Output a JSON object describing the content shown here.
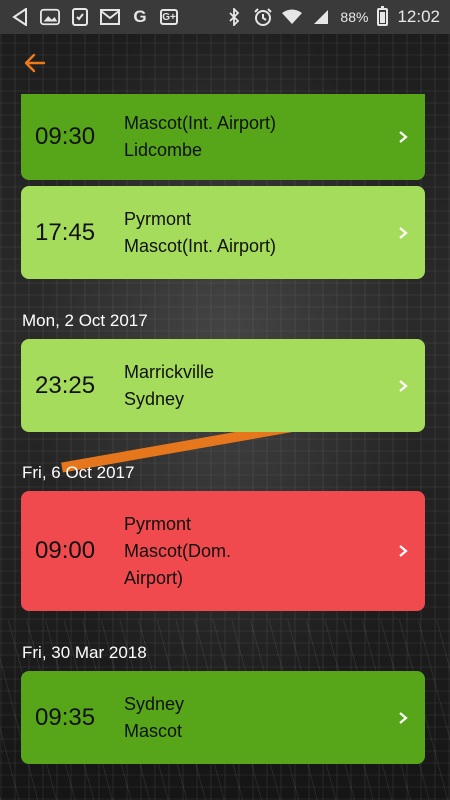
{
  "status_bar": {
    "battery": "88%",
    "time": "12:02",
    "icons": [
      "back-arrow-icon",
      "image-icon",
      "tablet-check-icon",
      "mail-icon",
      "google-g-icon",
      "google-plus-icon",
      "bluetooth-icon",
      "alarm-icon",
      "wifi-icon",
      "signal-icon",
      "battery-icon"
    ]
  },
  "appbar": {
    "back_icon": "arrow-left-icon",
    "accent": "#f07a1a"
  },
  "groups": [
    {
      "date": "",
      "trips": [
        {
          "time": "09:30",
          "from": "Mascot(Int. Airport)",
          "to": "Lidcombe",
          "color": "#57a518"
        },
        {
          "time": "17:45",
          "from": "Pyrmont",
          "to": "Mascot(Int. Airport)",
          "color": "#a6dc5b"
        }
      ]
    },
    {
      "date": "Mon, 2 Oct 2017",
      "trips": [
        {
          "time": "23:25",
          "from": "Marrickville",
          "to": "Sydney",
          "color": "#a6dc5b"
        }
      ]
    },
    {
      "date": "Fri, 6 Oct 2017",
      "trips": [
        {
          "time": "09:00",
          "from": "Pyrmont",
          "to": "Mascot(Dom. Airport)",
          "color": "#f04a4e"
        }
      ]
    },
    {
      "date": "Fri, 30 Mar 2018",
      "trips": [
        {
          "time": "09:35",
          "from": "Sydney",
          "to": "Mascot",
          "color": "#57a518"
        }
      ]
    }
  ]
}
